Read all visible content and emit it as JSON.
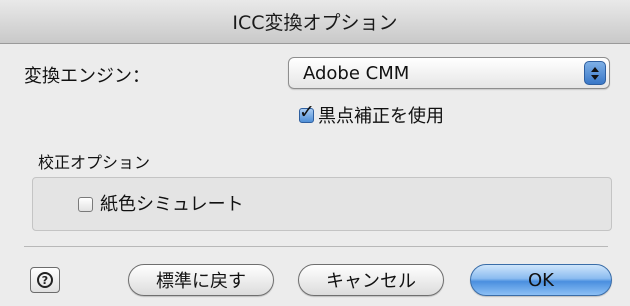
{
  "dialog": {
    "title": "ICC変換オプション"
  },
  "engine": {
    "label": "変換エンジン：",
    "selected": "Adobe CMM"
  },
  "black_point": {
    "label": "黒点補正を使用",
    "checked": true
  },
  "proof": {
    "group_label": "校正オプション",
    "paper_color": {
      "label": "紙色シミュレート",
      "checked": false
    }
  },
  "buttons": {
    "help_symbol": "?",
    "revert_label": "標準に戻す",
    "cancel_label": "キャンセル",
    "ok_label": "OK"
  },
  "icons": {
    "help": "help-icon",
    "select_arrows": "updown-arrows-icon",
    "check": "checkmark-icon"
  }
}
